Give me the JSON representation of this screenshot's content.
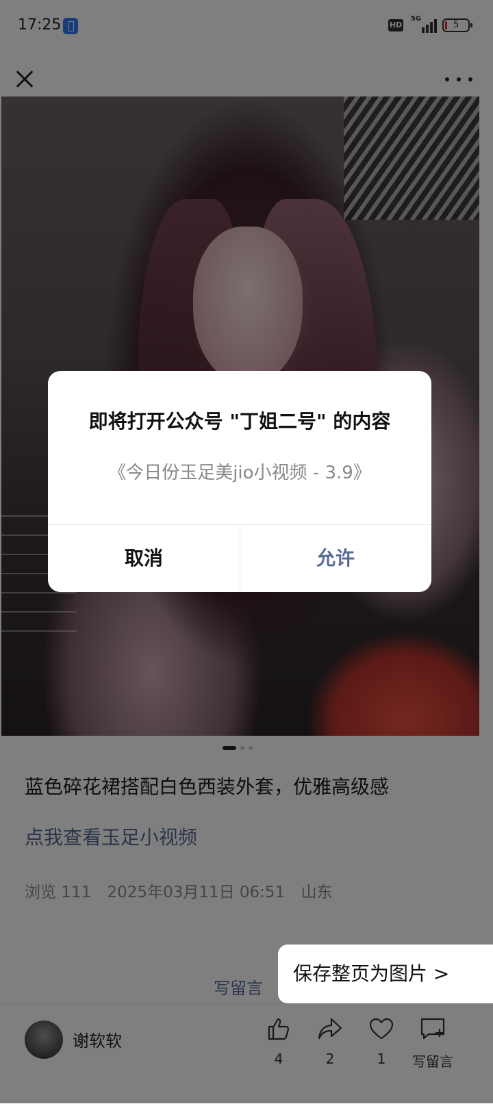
{
  "status_bar": {
    "time": "17:25",
    "hd_label": "HD",
    "network": "5G",
    "battery": "5",
    "battery_saver_icon": "battery-saver-icon"
  },
  "nav": {
    "close_icon": "close-icon",
    "more_icon": "more-icon"
  },
  "article": {
    "title": "蓝色碎花裙搭配白色西装外套，优雅高级感",
    "link_text": "点我查看玉足小视频",
    "views_label": "浏览 111",
    "date": "2025年03月11日 06:51",
    "location": "山东",
    "image_pager": {
      "total": 3,
      "current": 1
    }
  },
  "write_comment": "写留言",
  "save_page": "保存整页为图片 >",
  "bottom_bar": {
    "author": "谢软软",
    "like_count": "4",
    "share_count": "2",
    "heart_count": "1",
    "comment_label": "写留言"
  },
  "dialog": {
    "title": "即将打开公众号 \"丁姐二号\" 的内容",
    "subtitle": "《今日份玉足美jio小视频 - 3.9》",
    "cancel": "取消",
    "allow": "允许"
  },
  "colors": {
    "link": "#576b95",
    "overlay": "rgba(0,0,0,0.5)"
  }
}
